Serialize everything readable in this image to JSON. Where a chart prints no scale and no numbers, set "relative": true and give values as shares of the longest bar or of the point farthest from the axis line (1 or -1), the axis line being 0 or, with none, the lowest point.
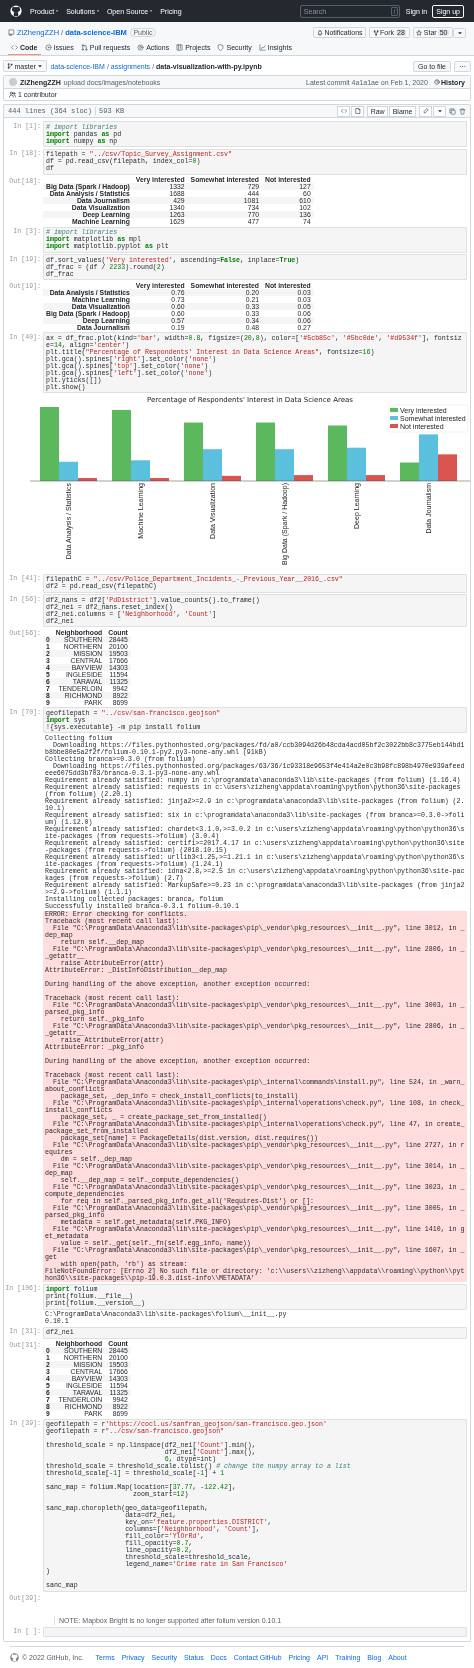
{
  "header": {
    "nav": [
      {
        "label": "Product",
        "dropdown": true
      },
      {
        "label": "Solutions",
        "dropdown": true
      },
      {
        "label": "Open Source",
        "dropdown": true
      },
      {
        "label": "Pricing",
        "dropdown": false
      }
    ],
    "search": {
      "placeholder": "Search",
      "key": "/"
    },
    "sign_in": "Sign in",
    "sign_up": "Sign up"
  },
  "repo": {
    "parts": [
      {
        "text": "ZiZhengZZH",
        "kind": "owner"
      },
      {
        "text": "/",
        "kind": "separator"
      },
      {
        "text": "data-science-IBM",
        "kind": "name"
      }
    ],
    "visibility": "Public",
    "notifications": "Notifications",
    "fork": "Fork",
    "fork_count": "28",
    "star": "Star",
    "star_count": "50"
  },
  "tabs": [
    {
      "label": "Code",
      "selected": true
    },
    {
      "label": "Issues",
      "selected": false
    },
    {
      "label": "Pull requests",
      "selected": false
    },
    {
      "label": "Actions",
      "selected": false
    },
    {
      "label": "Projects",
      "selected": false
    },
    {
      "label": "Security",
      "selected": false
    },
    {
      "label": "Insights",
      "selected": false
    }
  ],
  "breadcrumb": {
    "branch": "master",
    "parts": [
      {
        "text": "data-science-IBM",
        "kind": "link"
      },
      {
        "text": "/",
        "kind": "separator"
      },
      {
        "text": "assignments",
        "kind": "link"
      },
      {
        "text": "/",
        "kind": "separator"
      },
      {
        "text": "data-visualization-with-py.ipynb",
        "kind": "file"
      }
    ],
    "go_to_file": "Go to file",
    "more": "···"
  },
  "commit": {
    "author": "ZiZhengZZH",
    "message": "upload docs/images/notebooks",
    "latest": "Latest commit 4a1a1ae on Feb 1, 2020",
    "history": "History"
  },
  "contributors": "1 contributor",
  "file_info": {
    "lines": "444 lines (364 sloc)",
    "size": "593 KB",
    "raw": "Raw",
    "blame": "Blame"
  },
  "cells": [
    {
      "kind": "code",
      "prompt": "In [1]:",
      "code": "# import libraries\nimport pandas as pd\nimport numpy as np"
    },
    {
      "kind": "code",
      "prompt": "In [18]:",
      "code": "filepath = \"../csv/Topic_Survey_Assignment.csv\"\ndf = pd.read_csv(filepath, index_col=0)\ndf"
    },
    {
      "kind": "table",
      "prompt": "Out[18]:",
      "columns": [
        "Very interested",
        "Somewhat interested",
        "Not interested"
      ],
      "rows": [
        {
          "index": "Big Data (Spark / Hadoop)",
          "values": [
            "1332",
            "729",
            "127"
          ]
        },
        {
          "index": "Data Analysis / Statistics",
          "values": [
            "1688",
            "444",
            "60"
          ]
        },
        {
          "index": "Data Journalism",
          "values": [
            "429",
            "1081",
            "610"
          ]
        },
        {
          "index": "Data Visualization",
          "values": [
            "1340",
            "734",
            "102"
          ]
        },
        {
          "index": "Deep Learning",
          "values": [
            "1263",
            "770",
            "136"
          ]
        },
        {
          "index": "Machine Learning",
          "values": [
            "1629",
            "477",
            "74"
          ]
        }
      ]
    },
    {
      "kind": "code",
      "prompt": "In [3]:",
      "code": "# import libraries\nimport matplotlib as mpl\nimport matplotlib.pyplot as plt"
    },
    {
      "kind": "code",
      "prompt": "In [19]:",
      "code": "df.sort_values('Very interested', ascending=False, inplace=True)\ndf_frac = (df / 2233).round(2)\ndf_frac"
    },
    {
      "kind": "table",
      "prompt": "Out[19]:",
      "columns": [
        "Very interested",
        "Somewhat interested",
        "Not interested"
      ],
      "rows": [
        {
          "index": "Data Analysis / Statistics",
          "values": [
            "0.76",
            "0.20",
            "0.03"
          ]
        },
        {
          "index": "Machine Learning",
          "values": [
            "0.73",
            "0.21",
            "0.03"
          ]
        },
        {
          "index": "Data Visualization",
          "values": [
            "0.60",
            "0.33",
            "0.05"
          ]
        },
        {
          "index": "Big Data (Spark / Hadoop)",
          "values": [
            "0.60",
            "0.33",
            "0.06"
          ]
        },
        {
          "index": "Deep Learning",
          "values": [
            "0.57",
            "0.34",
            "0.06"
          ]
        },
        {
          "index": "Data Journalism",
          "values": [
            "0.19",
            "0.48",
            "0.27"
          ]
        }
      ]
    },
    {
      "kind": "code",
      "prompt": "In [40]:",
      "code": "ax = df_frac.plot(kind='bar', width=0.8, figsize=(20,8), color=['#5cb85c', '#5bc0de', '#d9534f'], fontsize=14, align='center')\nplt.title(\"Percentage of Respondents' Interest in Data Science Areas\", fontsize=16)\nplt.gca().spines['right'].set_color('none')\nplt.gca().spines['top'].set_color('none')\nplt.gca().spines['left'].set_color('none')\nplt.yticks([])\nplt.show()"
    },
    {
      "kind": "chart",
      "chart_data": {
        "type": "bar",
        "relative": true,
        "legend": "upper right",
        "title": "Percentage of Respondents' Interest in Data Science Areas",
        "categories": [
          "Data Analysis / Statistics",
          "Machine Learning",
          "Data Visualization",
          "Big Data (Spark / Hadoop)",
          "Deep Learning",
          "Data Journalism"
        ],
        "series": [
          {
            "name": "Very interested",
            "color": "#5cb85c",
            "values": [
              1,
              0.96,
              0.79,
              0.79,
              0.75,
              0.25
            ]
          },
          {
            "name": "Somewhat interested",
            "color": "#5bc0de",
            "values": [
              0.26,
              0.28,
              0.43,
              0.43,
              0.45,
              0.63
            ]
          },
          {
            "name": "Not interested",
            "color": "#d9534f",
            "values": [
              0.04,
              0.04,
              0.07,
              0.08,
              0.08,
              0.36
            ]
          }
        ]
      }
    },
    {
      "kind": "code",
      "prompt": "In [41]:",
      "code": "filepathC = \"../csv/Police_Department_Incidents_-_Previous_Year__2016_.csv\"\ndf2 = pd.read_csv(filepathC)"
    },
    {
      "kind": "code",
      "prompt": "In [56]:",
      "code": "df2_nans = df2['PdDistrict'].value_counts().to_frame()\ndf2_nei = df2_nans.reset_index()\ndf2_nei.columns = ['Neighborhood', 'Count']\ndf2_nei"
    },
    {
      "kind": "table",
      "prompt": "Out[56]:",
      "columns": [
        "Neighborhood",
        "Count"
      ],
      "rows": [
        {
          "index": "0",
          "values": [
            "SOUTHERN",
            "28445"
          ]
        },
        {
          "index": "1",
          "values": [
            "NORTHERN",
            "20100"
          ]
        },
        {
          "index": "2",
          "values": [
            "MISSION",
            "19503"
          ]
        },
        {
          "index": "3",
          "values": [
            "CENTRAL",
            "17666"
          ]
        },
        {
          "index": "4",
          "values": [
            "BAYVIEW",
            "14303"
          ]
        },
        {
          "index": "5",
          "values": [
            "INGLESIDE",
            "11594"
          ]
        },
        {
          "index": "6",
          "values": [
            "TARAVAL",
            "11325"
          ]
        },
        {
          "index": "7",
          "values": [
            "TENDERLOIN",
            "9942"
          ]
        },
        {
          "index": "8",
          "values": [
            "RICHMOND",
            "8922"
          ]
        },
        {
          "index": "9",
          "values": [
            "PARK",
            "8699"
          ]
        }
      ]
    },
    {
      "kind": "code",
      "prompt": "In [70]:",
      "code": "geofilepath = \"../csv/san-francisco.geojson\"\nimport sys\n!{sys.executable} -m pip install folium"
    },
    {
      "kind": "stream",
      "text": "Collecting folium\n  Downloading https://files.pythonhosted.org/packages/fd/a0/ccb3094d26b48cda4acd05bf2c3022bb8c3775eb144bd1b8bbe80e5a2f2f/folium-0.10.1-py2.py3-none-any.whl (91kB)\nCollecting branca>=0.3.0 (from folium)\n  Downloading https://files.pythonhosted.org/packages/63/36/1c93318e9653f4e414a2e0c3b98fc898b4970e939afeedeee6075dd3b703/branca-0.3.1-py3-none-any.whl\nRequirement already satisfied: numpy in c:\\programdata\\anaconda3\\lib\\site-packages (from folium) (1.16.4)\nRequirement already satisfied: requests in c:\\users\\zizheng\\appdata\\roaming\\python\\python36\\site-packages (from folium) (2.20.1)\nRequirement already satisfied: jinja2>=2.9 in c:\\programdata\\anaconda3\\lib\\site-packages (from folium) (2.10.1)\nRequirement already satisfied: six in c:\\programdata\\anaconda3\\lib\\site-packages (from branca>=0.3.0->folium) (1.12.0)\nRequirement already satisfied: chardet<3.1.0,>=3.0.2 in c:\\users\\zizheng\\appdata\\roaming\\python\\python36\\site-packages (from requests->folium) (3.0.4)\nRequirement already satisfied: certifi>=2017.4.17 in c:\\users\\zizheng\\appdata\\roaming\\python\\python36\\site-packages (from requests->folium) (2018.10.15)\nRequirement already satisfied: urllib3<1.25,>=1.21.1 in c:\\users\\zizheng\\appdata\\roaming\\python\\python36\\site-packages (from requests->folium) (1.24.1)\nRequirement already satisfied: idna<2.8,>=2.5 in c:\\users\\zizheng\\appdata\\roaming\\python\\python36\\site-packages (from requests->folium) (2.7)\nRequirement already satisfied: MarkupSafe>=0.23 in c:\\programdata\\anaconda3\\lib\\site-packages (from jinja2>=2.9->folium) (1.1.1)\nInstalling collected packages: branca, folium\nSuccessfully installed branca-0.3.1 folium-0.10.1"
    },
    {
      "kind": "error",
      "text": "ERROR: Error checking for conflicts.\nTraceback (most recent call last):\n  File \"C:\\ProgramData\\Anaconda3\\lib\\site-packages\\pip\\_vendor\\pkg_resources\\__init__.py\", line 3012, in _dep_map\n    return self.__dep_map\n  File \"C:\\ProgramData\\Anaconda3\\lib\\site-packages\\pip\\_vendor\\pkg_resources\\__init__.py\", line 2806, in __getattr__\n    raise AttributeError(attr)\nAttributeError: _DistInfoDistribution__dep_map\n\nDuring handling of the above exception, another exception occurred:\n\nTraceback (most recent call last):\n  File \"C:\\ProgramData\\Anaconda3\\lib\\site-packages\\pip\\_vendor\\pkg_resources\\__init__.py\", line 3003, in _parsed_pkg_info\n    return self._pkg_info\n  File \"C:\\ProgramData\\Anaconda3\\lib\\site-packages\\pip\\_vendor\\pkg_resources\\__init__.py\", line 2806, in __getattr__\n    raise AttributeError(attr)\nAttributeError: _pkg_info\n\nDuring handling of the above exception, another exception occurred:\n\nTraceback (most recent call last):\n  File \"C:\\ProgramData\\Anaconda3\\lib\\site-packages\\pip\\_internal\\commands\\install.py\", line 524, in _warn_about_conflicts\n    package_set, _dep_info = check_install_conflicts(to_install)\n  File \"C:\\ProgramData\\Anaconda3\\lib\\site-packages\\pip\\_internal\\operations\\check.py\", line 108, in check_install_conflicts\n    package_set, _ = create_package_set_from_installed()\n  File \"C:\\ProgramData\\Anaconda3\\lib\\site-packages\\pip\\_internal\\operations\\check.py\", line 47, in create_package_set_from_installed\n    package_set[name] = PackageDetails(dist.version, dist.requires())\n  File \"C:\\ProgramData\\Anaconda3\\lib\\site-packages\\pip\\_vendor\\pkg_resources\\__init__.py\", line 2727, in requires\n    dm = self._dep_map\n  File \"C:\\ProgramData\\Anaconda3\\lib\\site-packages\\pip\\_vendor\\pkg_resources\\__init__.py\", line 3014, in _dep_map\n    self.__dep_map = self._compute_dependencies()\n  File \"C:\\ProgramData\\Anaconda3\\lib\\site-packages\\pip\\_vendor\\pkg_resources\\__init__.py\", line 3023, in _compute_dependencies\n    for req in self._parsed_pkg_info.get_all('Requires-Dist') or []:\n  File \"C:\\ProgramData\\Anaconda3\\lib\\site-packages\\pip\\_vendor\\pkg_resources\\__init__.py\", line 3005, in _parsed_pkg_info\n    metadata = self.get_metadata(self.PKG_INFO)\n  File \"C:\\ProgramData\\Anaconda3\\lib\\site-packages\\pip\\_vendor\\pkg_resources\\__init__.py\", line 1410, in get_metadata\n    value = self._get(self._fn(self.egg_info, name))\n  File \"C:\\ProgramData\\Anaconda3\\lib\\site-packages\\pip\\_vendor\\pkg_resources\\__init__.py\", line 1607, in _get\n    with open(path, 'rb') as stream:\nFileNotFoundError: [Errno 2] No such file or directory: 'c:\\\\users\\\\zizheng\\\\appdata\\\\roaming\\\\python\\\\python36\\\\site-packages\\\\pip-19.0.3.dist-info\\\\METADATA'"
    },
    {
      "kind": "code",
      "prompt": "In [106]:",
      "code": "import folium\nprint(folium.__file__)\nprint(folium.__version__)"
    },
    {
      "kind": "stream",
      "text": "C:\\ProgramData\\Anaconda3\\lib\\site-packages\\folium\\__init__.py\n0.10.1"
    },
    {
      "kind": "code",
      "prompt": "In [31]:",
      "code": "df2_nei"
    },
    {
      "kind": "table",
      "prompt": "Out[31]:",
      "columns": [
        "Neighborhood",
        "Count"
      ],
      "rows": [
        {
          "index": "0",
          "values": [
            "SOUTHERN",
            "28445"
          ]
        },
        {
          "index": "1",
          "values": [
            "NORTHERN",
            "20100"
          ]
        },
        {
          "index": "2",
          "values": [
            "MISSION",
            "19503"
          ]
        },
        {
          "index": "3",
          "values": [
            "CENTRAL",
            "17666"
          ]
        },
        {
          "index": "4",
          "values": [
            "BAYVIEW",
            "14303"
          ]
        },
        {
          "index": "5",
          "values": [
            "INGLESIDE",
            "11594"
          ]
        },
        {
          "index": "6",
          "values": [
            "TARAVAL",
            "11325"
          ]
        },
        {
          "index": "7",
          "values": [
            "TENDERLOIN",
            "9942"
          ]
        },
        {
          "index": "8",
          "values": [
            "RICHMOND",
            "8922"
          ]
        },
        {
          "index": "9",
          "values": [
            "PARK",
            "8699"
          ]
        }
      ]
    },
    {
      "kind": "code",
      "prompt": "In [39]:",
      "code": "geofilepath = r'https://cocl.us/sanfran_geojson/san-francisco.geo.json'\ngeofilepath = r\"../csv/san-francisco.geojson\"\n\nthreshold_scale = np.linspace(df2_nei['Count'].min(),\n                              df2_nei['Count'].max(),\n                              6, dtype=int)\nthreshold_scale = threshold_scale.tolist() # change the numpy array to a list\nthreshold_scale[-1] = threshold_scale[-1] + 1\n\nsanc_map = folium.Map(location=[37.77, -122.42],\n                      zoom_start=12)\n\nsanc_map.choropleth(geo_data=geofilepath,\n                    data=df2_nei,\n                    key_on='feature.properties.DISTRICT',\n                    columns=['Neighborhood', 'Count'],\n                    fill_color='YlOrRd',\n                    fill_opacity=0.7,\n                    line_opacity=0.2,\n                    threshold_scale=threshold_scale,\n                    legend_name='Crime rate in San Francisco'\n)\n\nsanc_map"
    },
    {
      "kind": "blank",
      "prompt": "Out[39]:"
    },
    {
      "kind": "note",
      "text": "NOTE: Mapbox Bright is no longer supported after folium version 0.10.1"
    },
    {
      "kind": "code",
      "prompt": "In [ ]:"
    }
  ],
  "footer": {
    "copyright": "© 2022 GitHub, Inc.",
    "links": [
      "Terms",
      "Privacy",
      "Security",
      "Status",
      "Docs",
      "Contact GitHub",
      "Pricing",
      "API",
      "Training",
      "Blog",
      "About"
    ]
  }
}
